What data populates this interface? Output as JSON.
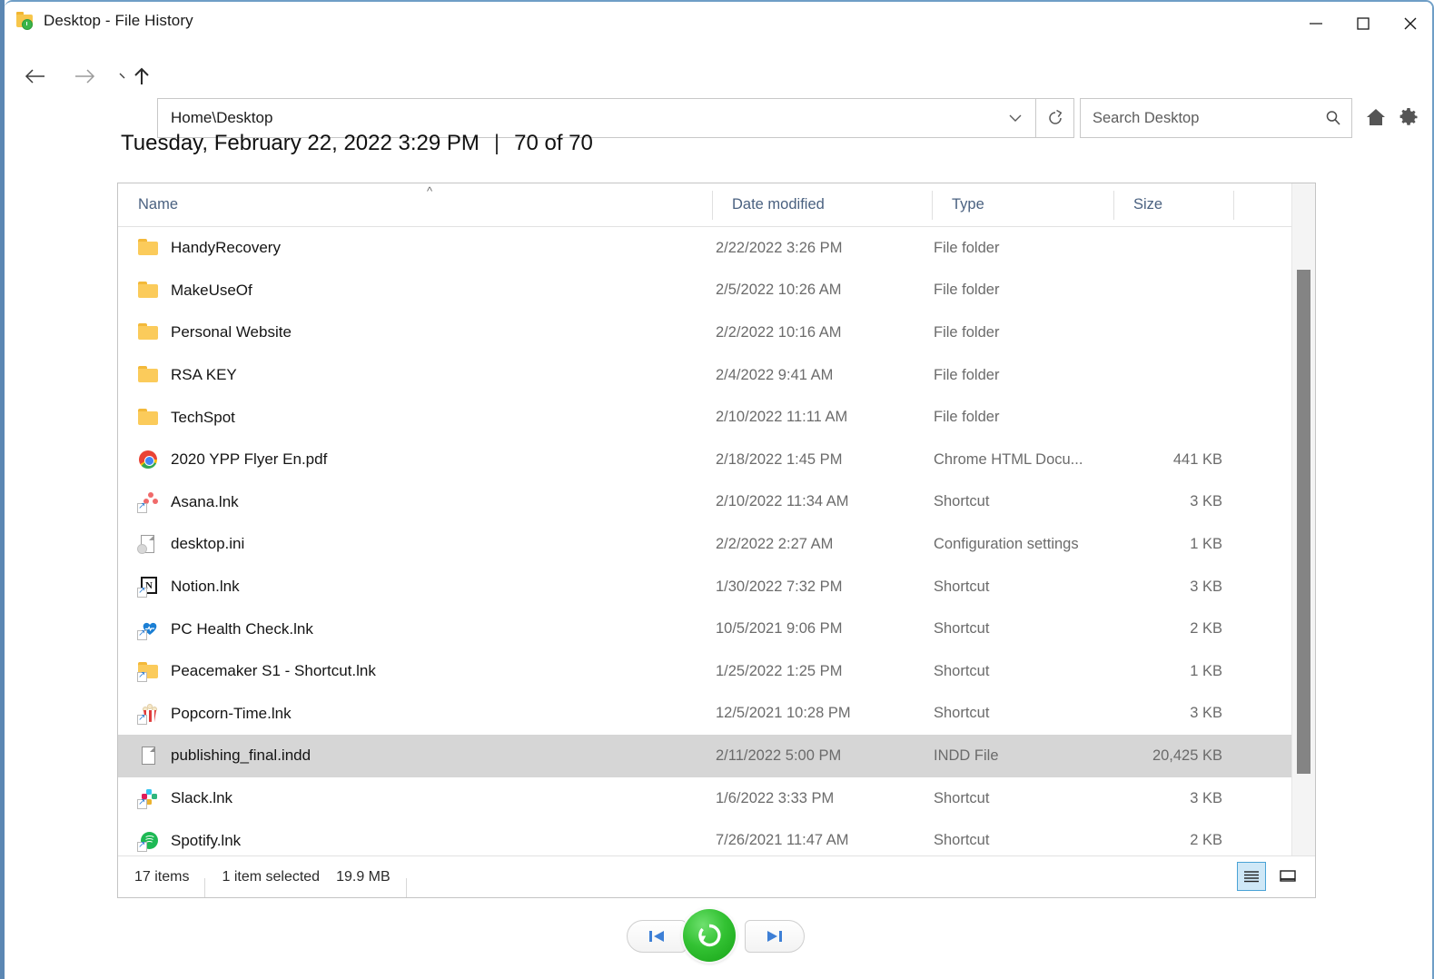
{
  "window": {
    "title": "Desktop - File History",
    "title_icon": "folder-clock-icon",
    "minimize_label": "Minimize",
    "maximize_label": "Maximize",
    "close_label": "Close"
  },
  "toolbar": {
    "back_label": "Back",
    "forward_label": "Forward",
    "recent_label": "Recent locations",
    "up_label": "Up",
    "address_value": "Home\\Desktop",
    "address_chevron": "chevron-down-icon",
    "refresh_label": "Refresh",
    "search_placeholder": "Search Desktop",
    "search_value": "",
    "search_icon": "search-icon",
    "home_icon": "home-icon",
    "settings_icon": "gear-icon"
  },
  "header": {
    "date": "Tuesday, February 22, 2022 3:29 PM",
    "separator": "|",
    "version": "70 of 70"
  },
  "list": {
    "columns": [
      {
        "label": "Name",
        "sort": "ascending"
      },
      {
        "label": "Date modified"
      },
      {
        "label": "Type"
      },
      {
        "label": "Size"
      }
    ],
    "rows": [
      {
        "name": "HandyRecovery",
        "icon": "folder-icon",
        "date": "2/22/2022 3:26 PM",
        "type": "File folder",
        "size": "",
        "selected": false
      },
      {
        "name": "MakeUseOf",
        "icon": "folder-icon",
        "date": "2/5/2022 10:26 AM",
        "type": "File folder",
        "size": "",
        "selected": false
      },
      {
        "name": "Personal Website",
        "icon": "folder-icon",
        "date": "2/2/2022 10:16 AM",
        "type": "File folder",
        "size": "",
        "selected": false
      },
      {
        "name": "RSA KEY",
        "icon": "folder-icon",
        "date": "2/4/2022 9:41 AM",
        "type": "File folder",
        "size": "",
        "selected": false
      },
      {
        "name": "TechSpot",
        "icon": "folder-icon",
        "date": "2/10/2022 11:11 AM",
        "type": "File folder",
        "size": "",
        "selected": false
      },
      {
        "name": "2020 YPP Flyer En.pdf",
        "icon": "chrome-icon",
        "date": "2/18/2022 1:45 PM",
        "type": "Chrome HTML Docu...",
        "size": "441 KB",
        "selected": false
      },
      {
        "name": "Asana.lnk",
        "icon": "asana-shortcut-icon",
        "date": "2/10/2022 11:34 AM",
        "type": "Shortcut",
        "size": "3 KB",
        "selected": false
      },
      {
        "name": "desktop.ini",
        "icon": "ini-file-icon",
        "date": "2/2/2022 2:27 AM",
        "type": "Configuration settings",
        "size": "1 KB",
        "selected": false
      },
      {
        "name": "Notion.lnk",
        "icon": "notion-shortcut-icon",
        "date": "1/30/2022 7:32 PM",
        "type": "Shortcut",
        "size": "3 KB",
        "selected": false
      },
      {
        "name": "PC Health Check.lnk",
        "icon": "pchealth-shortcut-icon",
        "date": "10/5/2021 9:06 PM",
        "type": "Shortcut",
        "size": "2 KB",
        "selected": false
      },
      {
        "name": "Peacemaker S1 - Shortcut.lnk",
        "icon": "folder-shortcut-icon",
        "date": "1/25/2022 1:25 PM",
        "type": "Shortcut",
        "size": "1 KB",
        "selected": false
      },
      {
        "name": "Popcorn-Time.lnk",
        "icon": "popcorn-shortcut-icon",
        "date": "12/5/2021 10:28 PM",
        "type": "Shortcut",
        "size": "3 KB",
        "selected": false
      },
      {
        "name": "publishing_final.indd",
        "icon": "blank-file-icon",
        "date": "2/11/2022 5:00 PM",
        "type": "INDD File",
        "size": "20,425 KB",
        "selected": true
      },
      {
        "name": "Slack.lnk",
        "icon": "slack-shortcut-icon",
        "date": "1/6/2022 3:33 PM",
        "type": "Shortcut",
        "size": "3 KB",
        "selected": false
      },
      {
        "name": "Spotify.lnk",
        "icon": "spotify-shortcut-icon",
        "date": "7/26/2021 11:47 AM",
        "type": "Shortcut",
        "size": "2 KB",
        "selected": false
      }
    ]
  },
  "status": {
    "item_count": "17 items",
    "selection": "1 item selected",
    "selection_size": "19.9 MB",
    "view_details_label": "Details view",
    "view_icons_label": "Large icons view",
    "active_view": "details"
  },
  "transport": {
    "previous_label": "Previous version",
    "restore_label": "Restore",
    "next_label": "Next version"
  }
}
